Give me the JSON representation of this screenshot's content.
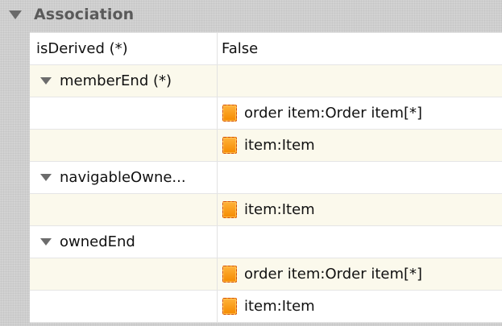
{
  "section": {
    "title": "Association",
    "toggle_icon": "expanded-triangle-icon"
  },
  "rows": [
    {
      "name": "isDerived (*)",
      "value": "False"
    },
    {
      "name": "memberEnd (*)",
      "expanded": true
    },
    {
      "value": "order item:Order item[*]",
      "icon": "property-icon"
    },
    {
      "value": "item:Item",
      "icon": "property-icon"
    },
    {
      "name": "navigableOwne...",
      "expanded": true
    },
    {
      "value": "item:Item",
      "icon": "property-icon"
    },
    {
      "name": "ownedEnd",
      "expanded": true
    },
    {
      "value": "order item:Order item[*]",
      "icon": "property-icon"
    },
    {
      "value": "item:Item",
      "icon": "property-icon"
    }
  ],
  "colors": {
    "header_text": "#5a5a5a",
    "alt_row": "#fbf9ec",
    "icon_orange": "#f58b00"
  }
}
